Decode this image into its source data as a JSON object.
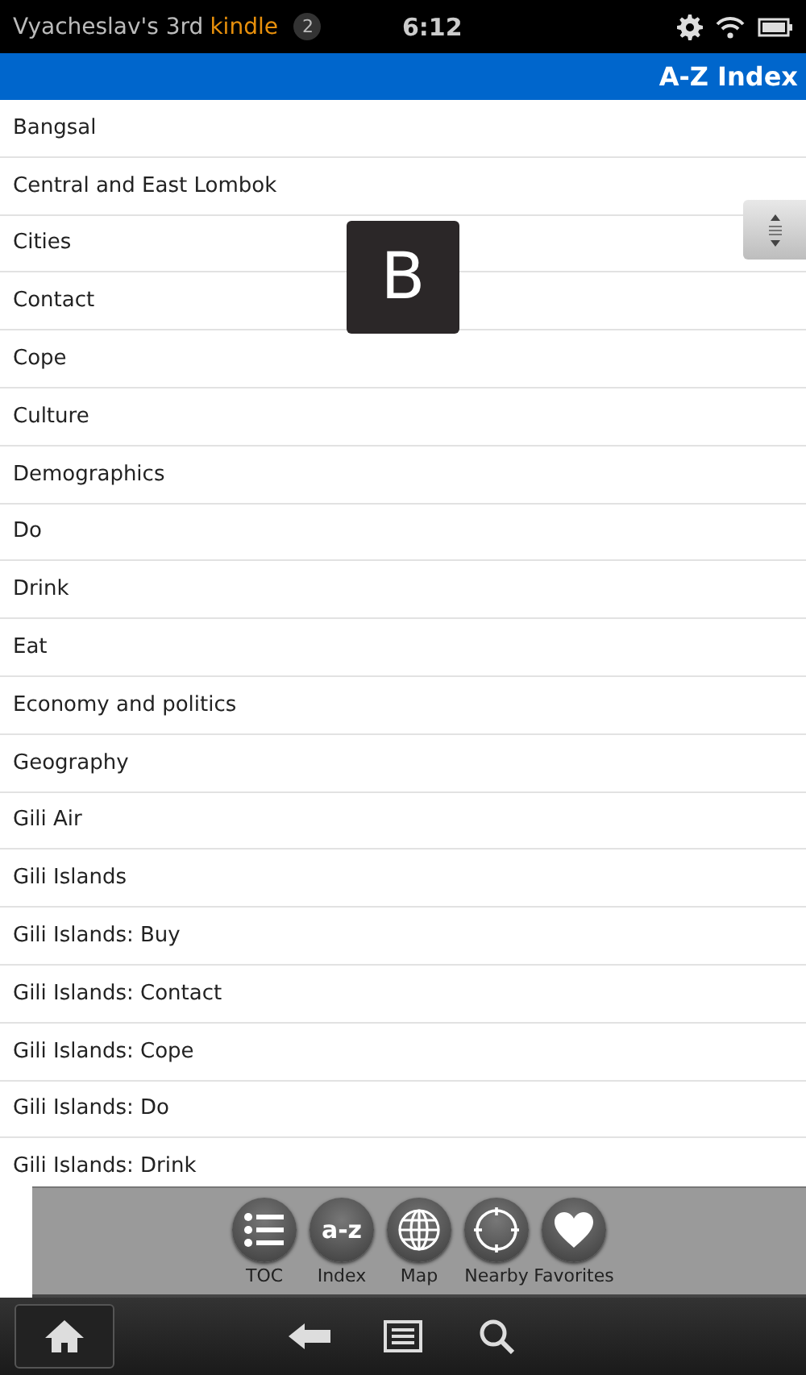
{
  "status_bar": {
    "device_name": "Vyacheslav's 3rd",
    "brand": "kindle",
    "notification_count": "2",
    "time": "6:12"
  },
  "header": {
    "title": "A-Z Index"
  },
  "letter_overlay": "B",
  "index_items": [
    "Bangsal",
    "Central and East Lombok",
    "Cities",
    "Contact",
    "Cope",
    "Culture",
    "Demographics",
    "Do",
    "Drink",
    "Eat",
    "Economy and politics",
    "Geography",
    "Gili Air",
    "Gili Islands",
    "Gili Islands: Buy",
    "Gili Islands: Contact",
    "Gili Islands: Cope",
    "Gili Islands: Do",
    "Gili Islands: Drink"
  ],
  "toolbar": [
    {
      "kind": "toc",
      "label": "TOC"
    },
    {
      "kind": "index",
      "label": "Index",
      "glyph": "a-z"
    },
    {
      "kind": "map",
      "label": "Map"
    },
    {
      "kind": "nearby",
      "label": "Nearby"
    },
    {
      "kind": "favorites",
      "label": "Favorites"
    }
  ]
}
